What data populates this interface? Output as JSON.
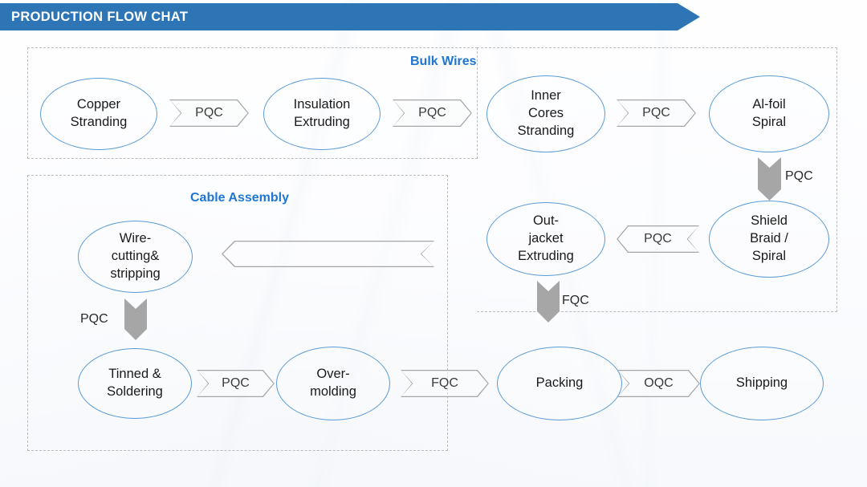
{
  "header": {
    "title": "PRODUCTION FLOW CHAT",
    "ribbon_color": "#2e75b6",
    "text_color": "#ffffff"
  },
  "theme": {
    "node_border": "#5b9bd5",
    "group_title_color": "#1f76d2",
    "connector_color": "#a6a6a6",
    "group_border": "#b6bcc2",
    "background": "#f4f7fa"
  },
  "groups": [
    {
      "id": "bulk-wires",
      "label": "Bulk Wires"
    },
    {
      "id": "cable-assembly",
      "label": "Cable Assembly"
    }
  ],
  "nodes": {
    "copper_stranding": "Copper\nStranding",
    "insulation_extruding": "Insulation\nExtruding",
    "inner_cores_stranding": "Inner\nCores\nStranding",
    "al_foil_spiral": "Al-foil\nSpiral",
    "shield_braid_spiral": "Shield\nBraid /\nSpiral",
    "out_jacket_extruding": "Out-\njacket\nExtruding",
    "wire_cutting_stripping": "Wire-\ncutting&\nstripping",
    "tinned_soldering": "Tinned &\nSoldering",
    "over_molding": "Over-\nmolding",
    "packing": "Packing",
    "shipping": "Shipping"
  },
  "connectors": {
    "copper_to_insulation": "PQC",
    "insulation_to_inner": "PQC",
    "inner_to_alfoil": "PQC",
    "alfoil_to_shield": "PQC",
    "shield_to_outjacket": "PQC",
    "outjacket_down": "FQC",
    "wirecut_to_tinned": "PQC",
    "tinned_to_overmolding": "PQC",
    "overmolding_to_packing": "FQC",
    "packing_to_shipping": "OQC",
    "feedback_loop": ""
  },
  "chart_data": {
    "type": "diagram",
    "title": "PRODUCTION FLOW CHAT",
    "nodes": [
      "Copper Stranding",
      "Insulation Extruding",
      "Inner Cores Stranding",
      "Al-foil Spiral",
      "Shield Braid / Spiral",
      "Out-jacket Extruding",
      "Wire-cutting& stripping",
      "Tinned & Soldering",
      "Over-molding",
      "Packing",
      "Shipping"
    ],
    "edges": [
      {
        "from": "Copper Stranding",
        "to": "Insulation Extruding",
        "label": "PQC",
        "direction": "right"
      },
      {
        "from": "Insulation Extruding",
        "to": "Inner Cores Stranding",
        "label": "PQC",
        "direction": "right"
      },
      {
        "from": "Inner Cores Stranding",
        "to": "Al-foil Spiral",
        "label": "PQC",
        "direction": "right"
      },
      {
        "from": "Al-foil Spiral",
        "to": "Shield Braid / Spiral",
        "label": "PQC",
        "direction": "down"
      },
      {
        "from": "Shield Braid / Spiral",
        "to": "Out-jacket Extruding",
        "label": "PQC",
        "direction": "left"
      },
      {
        "from": "Out-jacket Extruding",
        "to": "Wire-cutting& stripping",
        "label": "FQC",
        "direction": "down"
      },
      {
        "from": "Wire-cutting& stripping",
        "to": "Tinned & Soldering",
        "label": "PQC",
        "direction": "down"
      },
      {
        "from": "Tinned & Soldering",
        "to": "Over-molding",
        "label": "PQC",
        "direction": "right"
      },
      {
        "from": "Over-molding",
        "to": "Packing",
        "label": "FQC",
        "direction": "right"
      },
      {
        "from": "Packing",
        "to": "Shipping",
        "label": "OQC",
        "direction": "right"
      }
    ],
    "groups": [
      {
        "label": "Bulk Wires",
        "members": [
          "Copper Stranding",
          "Insulation Extruding",
          "Inner Cores Stranding",
          "Al-foil Spiral",
          "Shield Braid / Spiral",
          "Out-jacket Extruding"
        ]
      },
      {
        "label": "Cable Assembly",
        "members": [
          "Wire-cutting& stripping",
          "Tinned & Soldering",
          "Over-molding"
        ]
      }
    ]
  }
}
